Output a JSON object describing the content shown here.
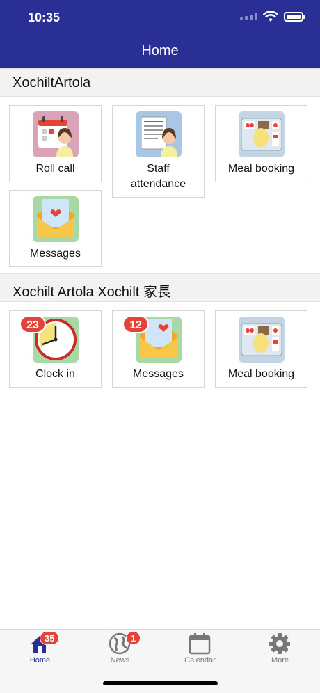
{
  "status": {
    "time": "10:35"
  },
  "header": {
    "title": "Home"
  },
  "sections": [
    {
      "title": "XochiltArtola",
      "tiles": [
        {
          "label": "Roll call",
          "icon": "roll-call-icon"
        },
        {
          "label": "Staff\nattendance",
          "icon": "staff-attendance-icon"
        },
        {
          "label": "Meal booking",
          "icon": "meal-booking-icon"
        },
        {
          "label": "Messages",
          "icon": "messages-icon"
        }
      ]
    },
    {
      "title": "Xochilt Artola Xochilt 家長",
      "tiles": [
        {
          "label": "Clock in",
          "icon": "clock-icon",
          "badge": "23"
        },
        {
          "label": "Messages",
          "icon": "messages-icon",
          "badge": "12"
        },
        {
          "label": "Meal booking",
          "icon": "meal-booking-icon"
        }
      ]
    }
  ],
  "tabbar": {
    "tabs": [
      {
        "label": "Home",
        "icon": "home-icon",
        "badge": "35",
        "active": true
      },
      {
        "label": "News",
        "icon": "globe-icon",
        "badge": "1"
      },
      {
        "label": "Calendar",
        "icon": "calendar-icon"
      },
      {
        "label": "More",
        "icon": "gear-icon"
      }
    ]
  },
  "colors": {
    "header": "#2a2f96",
    "badge": "#e5423a",
    "active_tab": "#2a2f96",
    "inactive_tab": "#777777"
  }
}
